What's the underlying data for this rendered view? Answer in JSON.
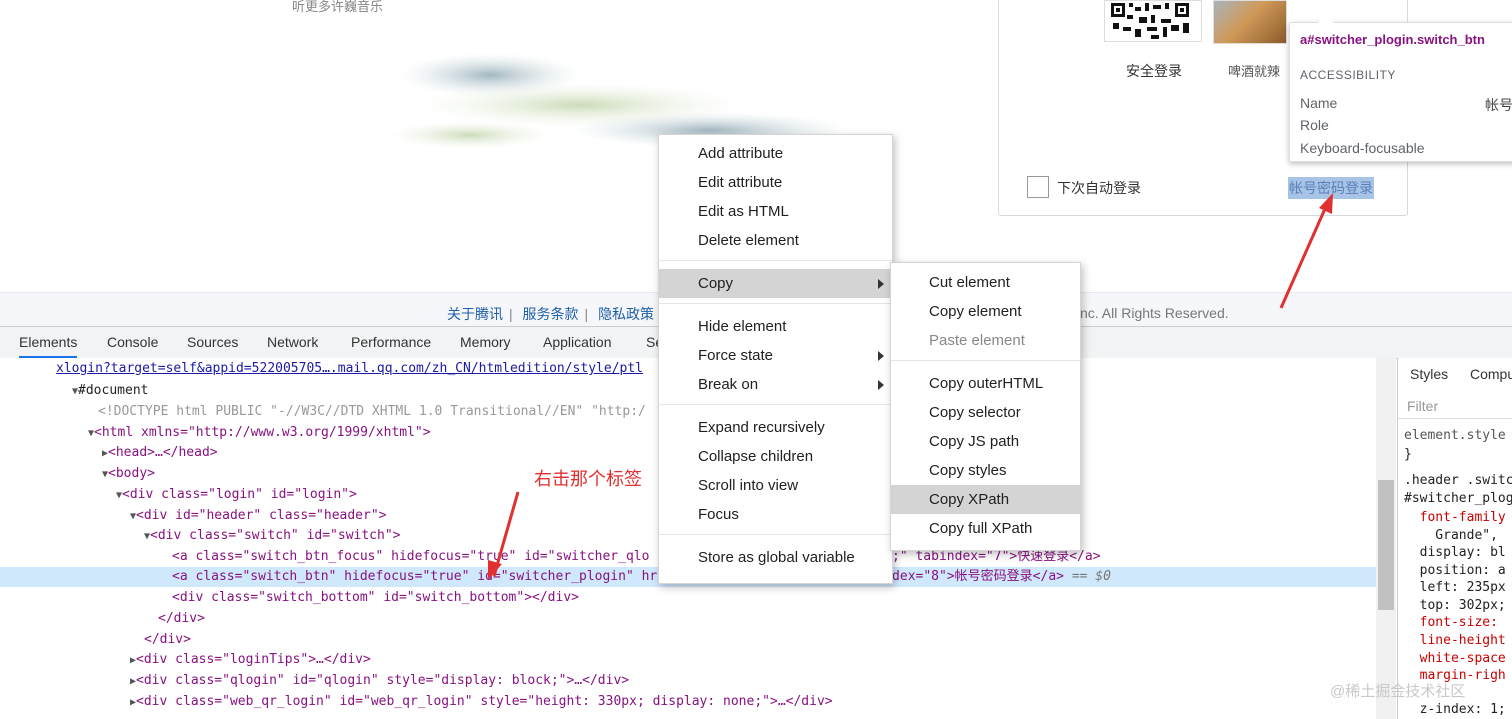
{
  "page": {
    "subtitle": "听更多许巍音乐",
    "qr_label": "安全登录",
    "avatar_label": "啤酒就辣",
    "auto_login_label": "下次自动登录",
    "password_login_link": "帐号密码登录",
    "footer_links": [
      "关于腾讯",
      "服务条款",
      "隐私政策"
    ],
    "footer_rights": "nc. All Rights Reserved."
  },
  "tooltip": {
    "title": "a#switcher_plogin.switch_btn",
    "section": "ACCESSIBILITY",
    "rows": [
      {
        "label": "Name",
        "value": "帐号"
      },
      {
        "label": "Role",
        "value": ""
      },
      {
        "label": "Keyboard-focusable",
        "value": ""
      }
    ]
  },
  "devtools": {
    "tabs": [
      "Elements",
      "Console",
      "Sources",
      "Network",
      "Performance",
      "Memory",
      "Application",
      "Se"
    ],
    "active_tab": "Elements",
    "styles_tabs": [
      "Styles",
      "Compu"
    ],
    "filter_placeholder": "Filter",
    "dom": {
      "url": "xlogin?target=self&appid=522005705….mail.qq.com/zh_CN/htmledition/style/ptl",
      "document": "#document",
      "doctype": "<!DOCTYPE html PUBLIC \"-//W3C//DTD XHTML 1.0 Transitional//EN\" \"http:/",
      "html_open": "<html xmlns=\"http://www.w3.org/1999/xhtml\">",
      "head": "<head>…</head>",
      "body": "<body>",
      "div_login": "<div class=\"login\" id=\"login\">",
      "div_header": "<div id=\"header\" class=\"header\">",
      "div_switch": "<div class=\"switch\" id=\"switch\">",
      "a_qlogin_start": "<a class=\"switch_btn_focus\" hidefocus=\"true\" id=\"switcher_qlo",
      "a_qlogin_end": ";\" tabindex=\"7\">快速登录</a>",
      "a_plogin": "<a class=\"switch_btn\" hidefocus=\"true\" id=\"switcher_plogin\" href=\"javascript:void(0);\" tabindex=\"8\">帐号密码登录</a>",
      "a_plogin_eq": "== $0",
      "div_switch_bottom": "<div class=\"switch_bottom\" id=\"switch_bottom\"></div>",
      "close_div_1": "</div>",
      "close_div_2": "</div>",
      "div_loginTips": "<div class=\"loginTips\">…</div>",
      "div_qlogin": "<div class=\"qlogin\" id=\"qlogin\" style=\"display: block;\">…</div>",
      "div_web_qr": "<div class=\"web_qr_login\" id=\"web_qr_login\" style=\"height: 330px; display: none;\">…</div>"
    },
    "styles": [
      "element.style",
      "}",
      ".header .switc",
      "#switcher_plog",
      "  font-family",
      "    Grande\",",
      "  display: bl",
      "  position: a",
      "  left: 235px",
      "  top: 302px;",
      "  font-size:",
      "  line-height",
      "  white-space",
      "  margin-righ",
      "  z-index: 1;"
    ]
  },
  "annotation": "右击那个标签",
  "context_menu": {
    "items": [
      "Add attribute",
      "Edit attribute",
      "Edit as HTML",
      "Delete element",
      "Copy",
      "Hide element",
      "Force state",
      "Break on",
      "Expand recursively",
      "Collapse children",
      "Scroll into view",
      "Focus",
      "Store as global variable"
    ],
    "highlighted": "Copy"
  },
  "copy_submenu": {
    "items": [
      "Cut element",
      "Copy element",
      "Paste element",
      "Copy outerHTML",
      "Copy selector",
      "Copy JS path",
      "Copy styles",
      "Copy XPath",
      "Copy full XPath"
    ],
    "highlighted": "Copy XPath",
    "disabled": "Paste element"
  },
  "watermark": "@稀土掘金技术社区",
  "colors": {
    "arrow_red": "#e03030",
    "menu_highlight": "#d4d4d4",
    "selected_row": "#cfe8fc"
  }
}
